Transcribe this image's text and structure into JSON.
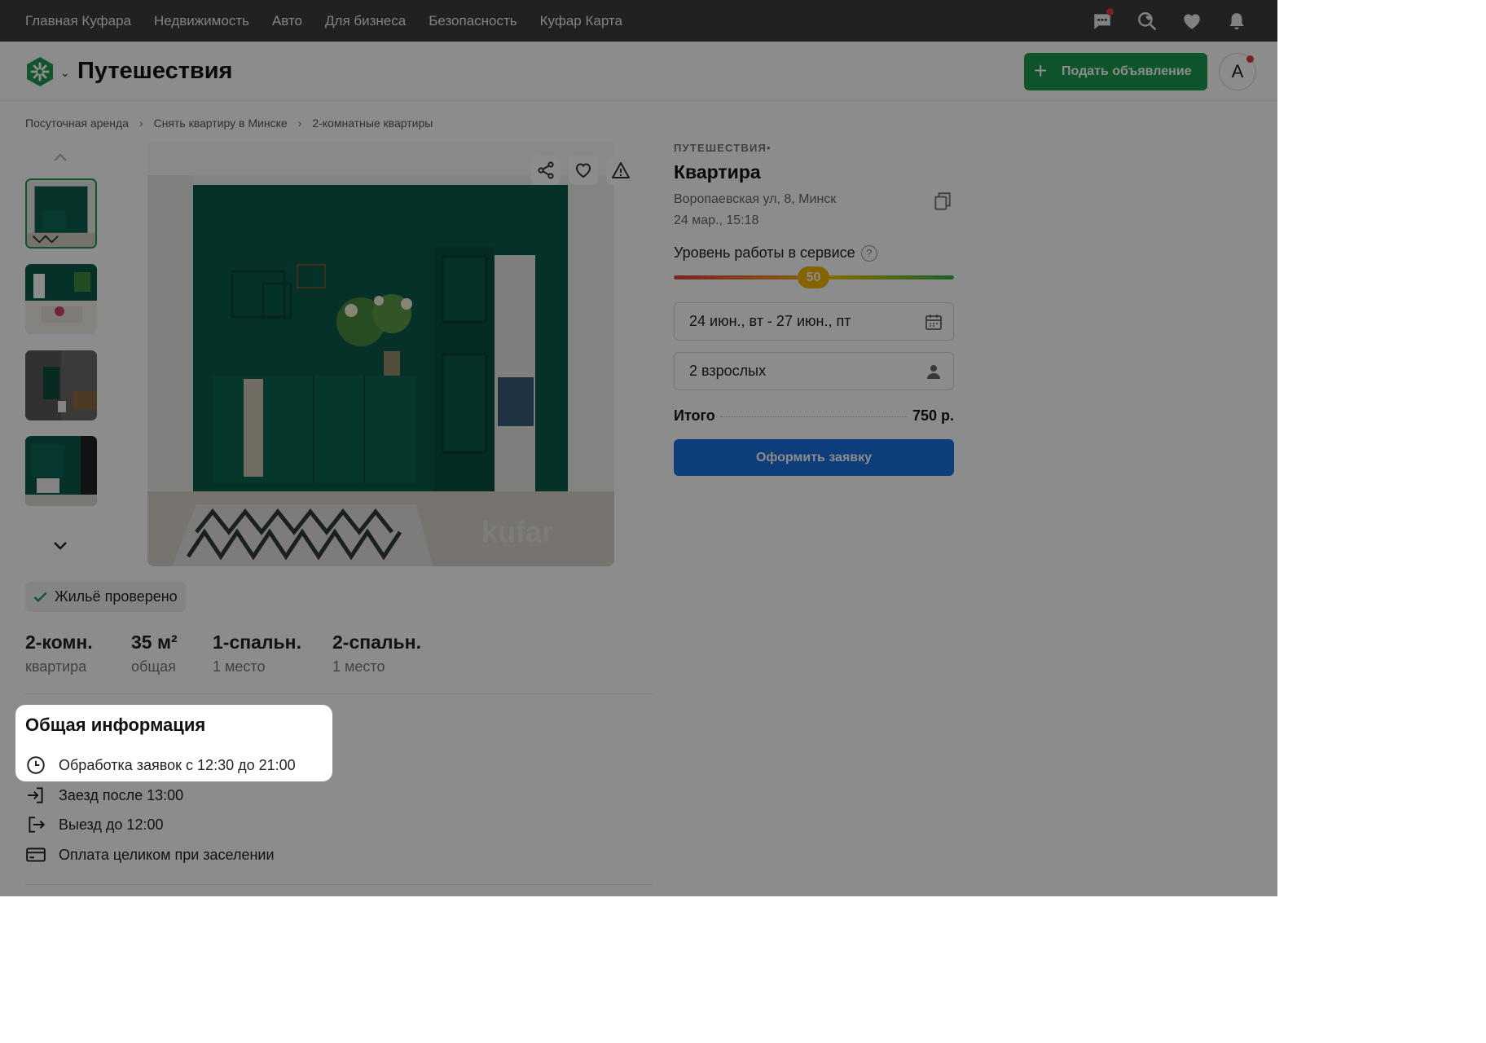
{
  "topbar": {
    "nav": [
      "Главная Куфара",
      "Недвижимость",
      "Авто",
      "Для бизнеса",
      "Безопасность",
      "Куфар Карта"
    ],
    "icons": [
      "chat-icon",
      "search-heart-icon",
      "heart-icon",
      "bell-icon"
    ]
  },
  "header": {
    "title": "Путешествия",
    "post_button": "Подать объявление",
    "avatar_letter": "А"
  },
  "breadcrumb": [
    "Посуточная аренда",
    "Снять квартиру в Минске",
    "2-комнатные квартиры"
  ],
  "listing": {
    "category": "ПУТЕШЕСТВИЯ•",
    "title": "Квартира",
    "address": "Воропаевская ул, 8, Минск",
    "date": "24 мар., 15:18",
    "service_label": "Уровень работы в сервисе",
    "service_help": "?",
    "service_level": "50",
    "dates_value": "24 июн., вт - 27 июн., пт",
    "guests_value": "2 взрослых",
    "total_label": "Итого",
    "total_value": "750 р.",
    "submit": "Оформить заявку"
  },
  "verified": "Жильё проверено",
  "watermark": "kufar",
  "stats": [
    {
      "value": "2-комн.",
      "label": "квартира"
    },
    {
      "value": "35 м²",
      "label": "общая"
    },
    {
      "value": "1-спальн.",
      "label": "1 место"
    },
    {
      "value": "2-спальн.",
      "label": "1 место"
    }
  ],
  "general_info": {
    "title": "Общая информация",
    "rows": [
      {
        "icon": "clock-icon",
        "text": "Обработка заявок с 12:30 до 21:00"
      },
      {
        "icon": "check-in-icon",
        "text": "Заезд после 13:00"
      },
      {
        "icon": "check-out-icon",
        "text": "Выезд до 12:00"
      },
      {
        "icon": "card-icon",
        "text": "Оплата целиком при заселении"
      }
    ]
  },
  "colors": {
    "topbar": "#3d3d3d",
    "brand_green": "#1d9b4f",
    "primary_blue": "#1a6fe0",
    "slider_knob": "#f0b400",
    "overlay": "rgba(0,0,0,0.45)"
  }
}
